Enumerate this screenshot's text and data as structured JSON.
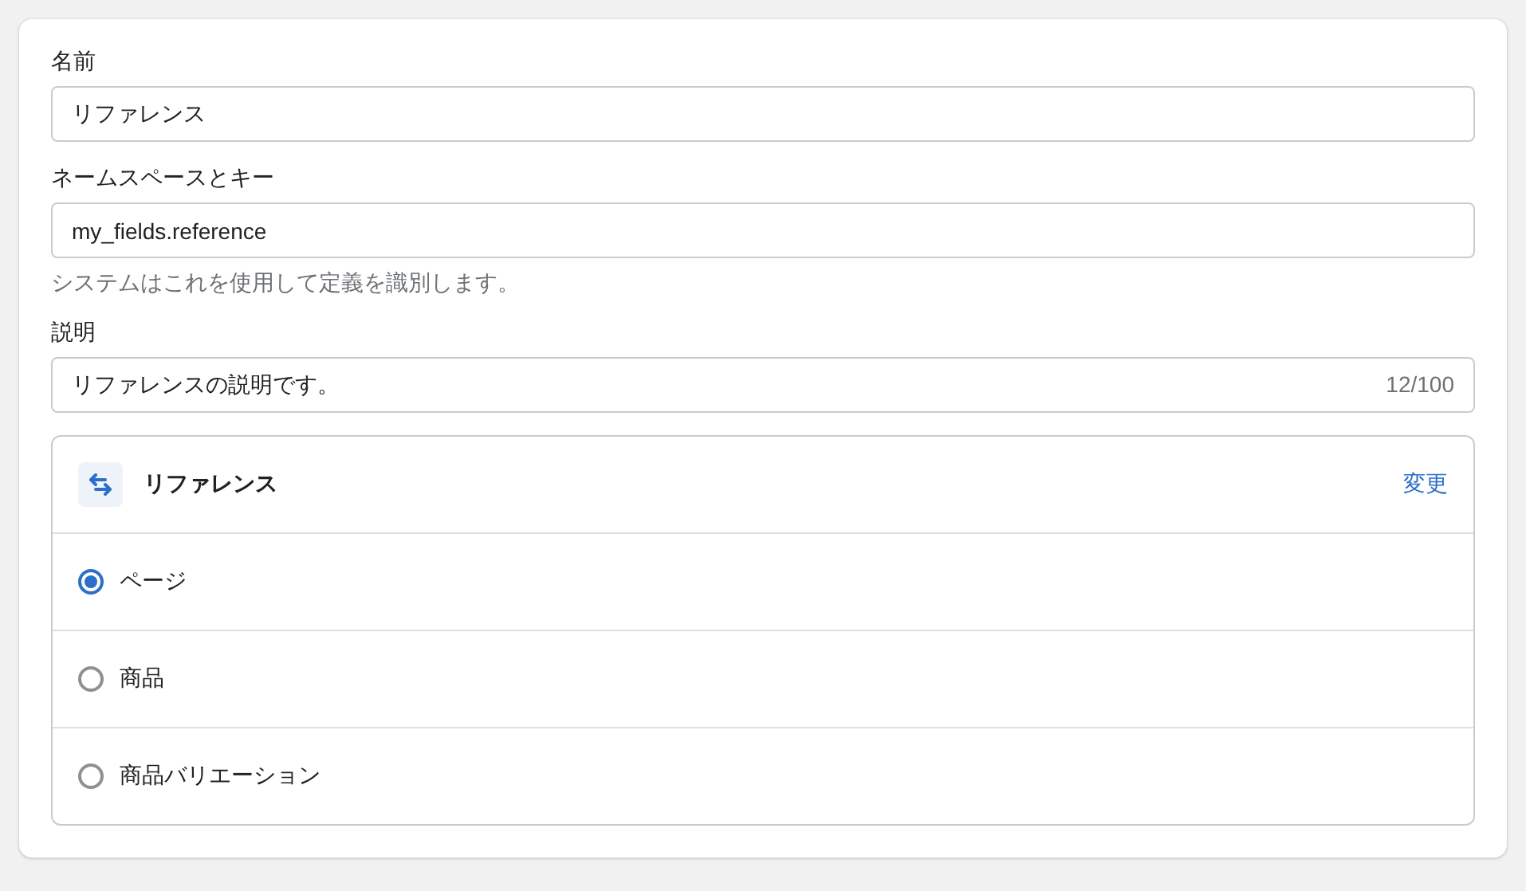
{
  "fields": [
    {
      "label": "名前",
      "value": "リファレンス"
    },
    {
      "label": "ネームスペースとキー",
      "value": "my_fields.reference",
      "help": "システムはこれを使用して定義を識別します。"
    },
    {
      "label": "説明",
      "value": "リファレンスの説明です。",
      "counter": "12/100"
    }
  ],
  "reference": {
    "title": "リファレンス",
    "action": "変更",
    "options": [
      {
        "label": "ページ",
        "selected": true
      },
      {
        "label": "商品",
        "selected": false
      },
      {
        "label": "商品バリエーション",
        "selected": false
      }
    ]
  }
}
